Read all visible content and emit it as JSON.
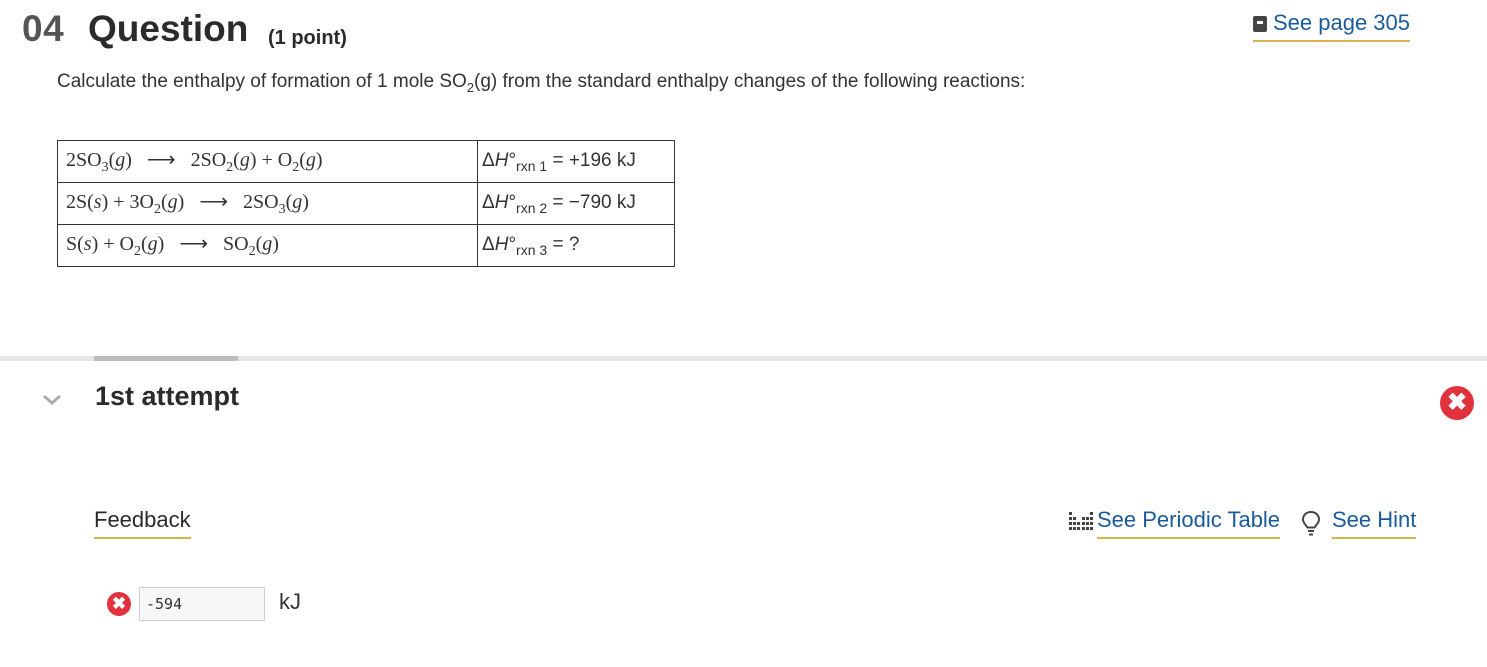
{
  "header": {
    "number": "04",
    "title": "Question",
    "points": "(1 point)",
    "see_page": "See page 305"
  },
  "question": {
    "prompt_before": "Calculate the enthalpy of formation of 1 mole SO",
    "prompt_sub": "2",
    "prompt_after": "(g) from the standard enthalpy changes of the following reactions:"
  },
  "reactions": [
    {
      "lhs": [
        "2SO",
        "3",
        "(",
        "g",
        ")"
      ],
      "rhs": [
        "2SO",
        "2",
        "(",
        "g",
        ") + O",
        "2",
        "(",
        "g",
        ")"
      ],
      "dh_label": "rxn 1",
      "dh_value": "= +196 kJ"
    },
    {
      "lhs": [
        "2S(",
        "s",
        ") + 3O",
        "2",
        "(",
        "g",
        ")"
      ],
      "rhs": [
        "2SO",
        "3",
        "(",
        "g",
        ")"
      ],
      "dh_label": "rxn 2",
      "dh_value": "= −790 kJ"
    },
    {
      "lhs": [
        "S(",
        "s",
        ") + O",
        "2",
        "(",
        "g",
        ")"
      ],
      "rhs": [
        "SO",
        "2",
        "(",
        "g",
        ")"
      ],
      "dh_label": "rxn 3",
      "dh_value": "= ?"
    }
  ],
  "attempt": {
    "title": "1st attempt",
    "feedback_label": "Feedback",
    "see_periodic_table": "See Periodic Table",
    "see_hint": "See Hint",
    "answer_value": "-594",
    "unit": "kJ"
  },
  "colors": {
    "link": "#1a5b9a",
    "underline": "#d8b24a",
    "error": "#e0313c"
  }
}
